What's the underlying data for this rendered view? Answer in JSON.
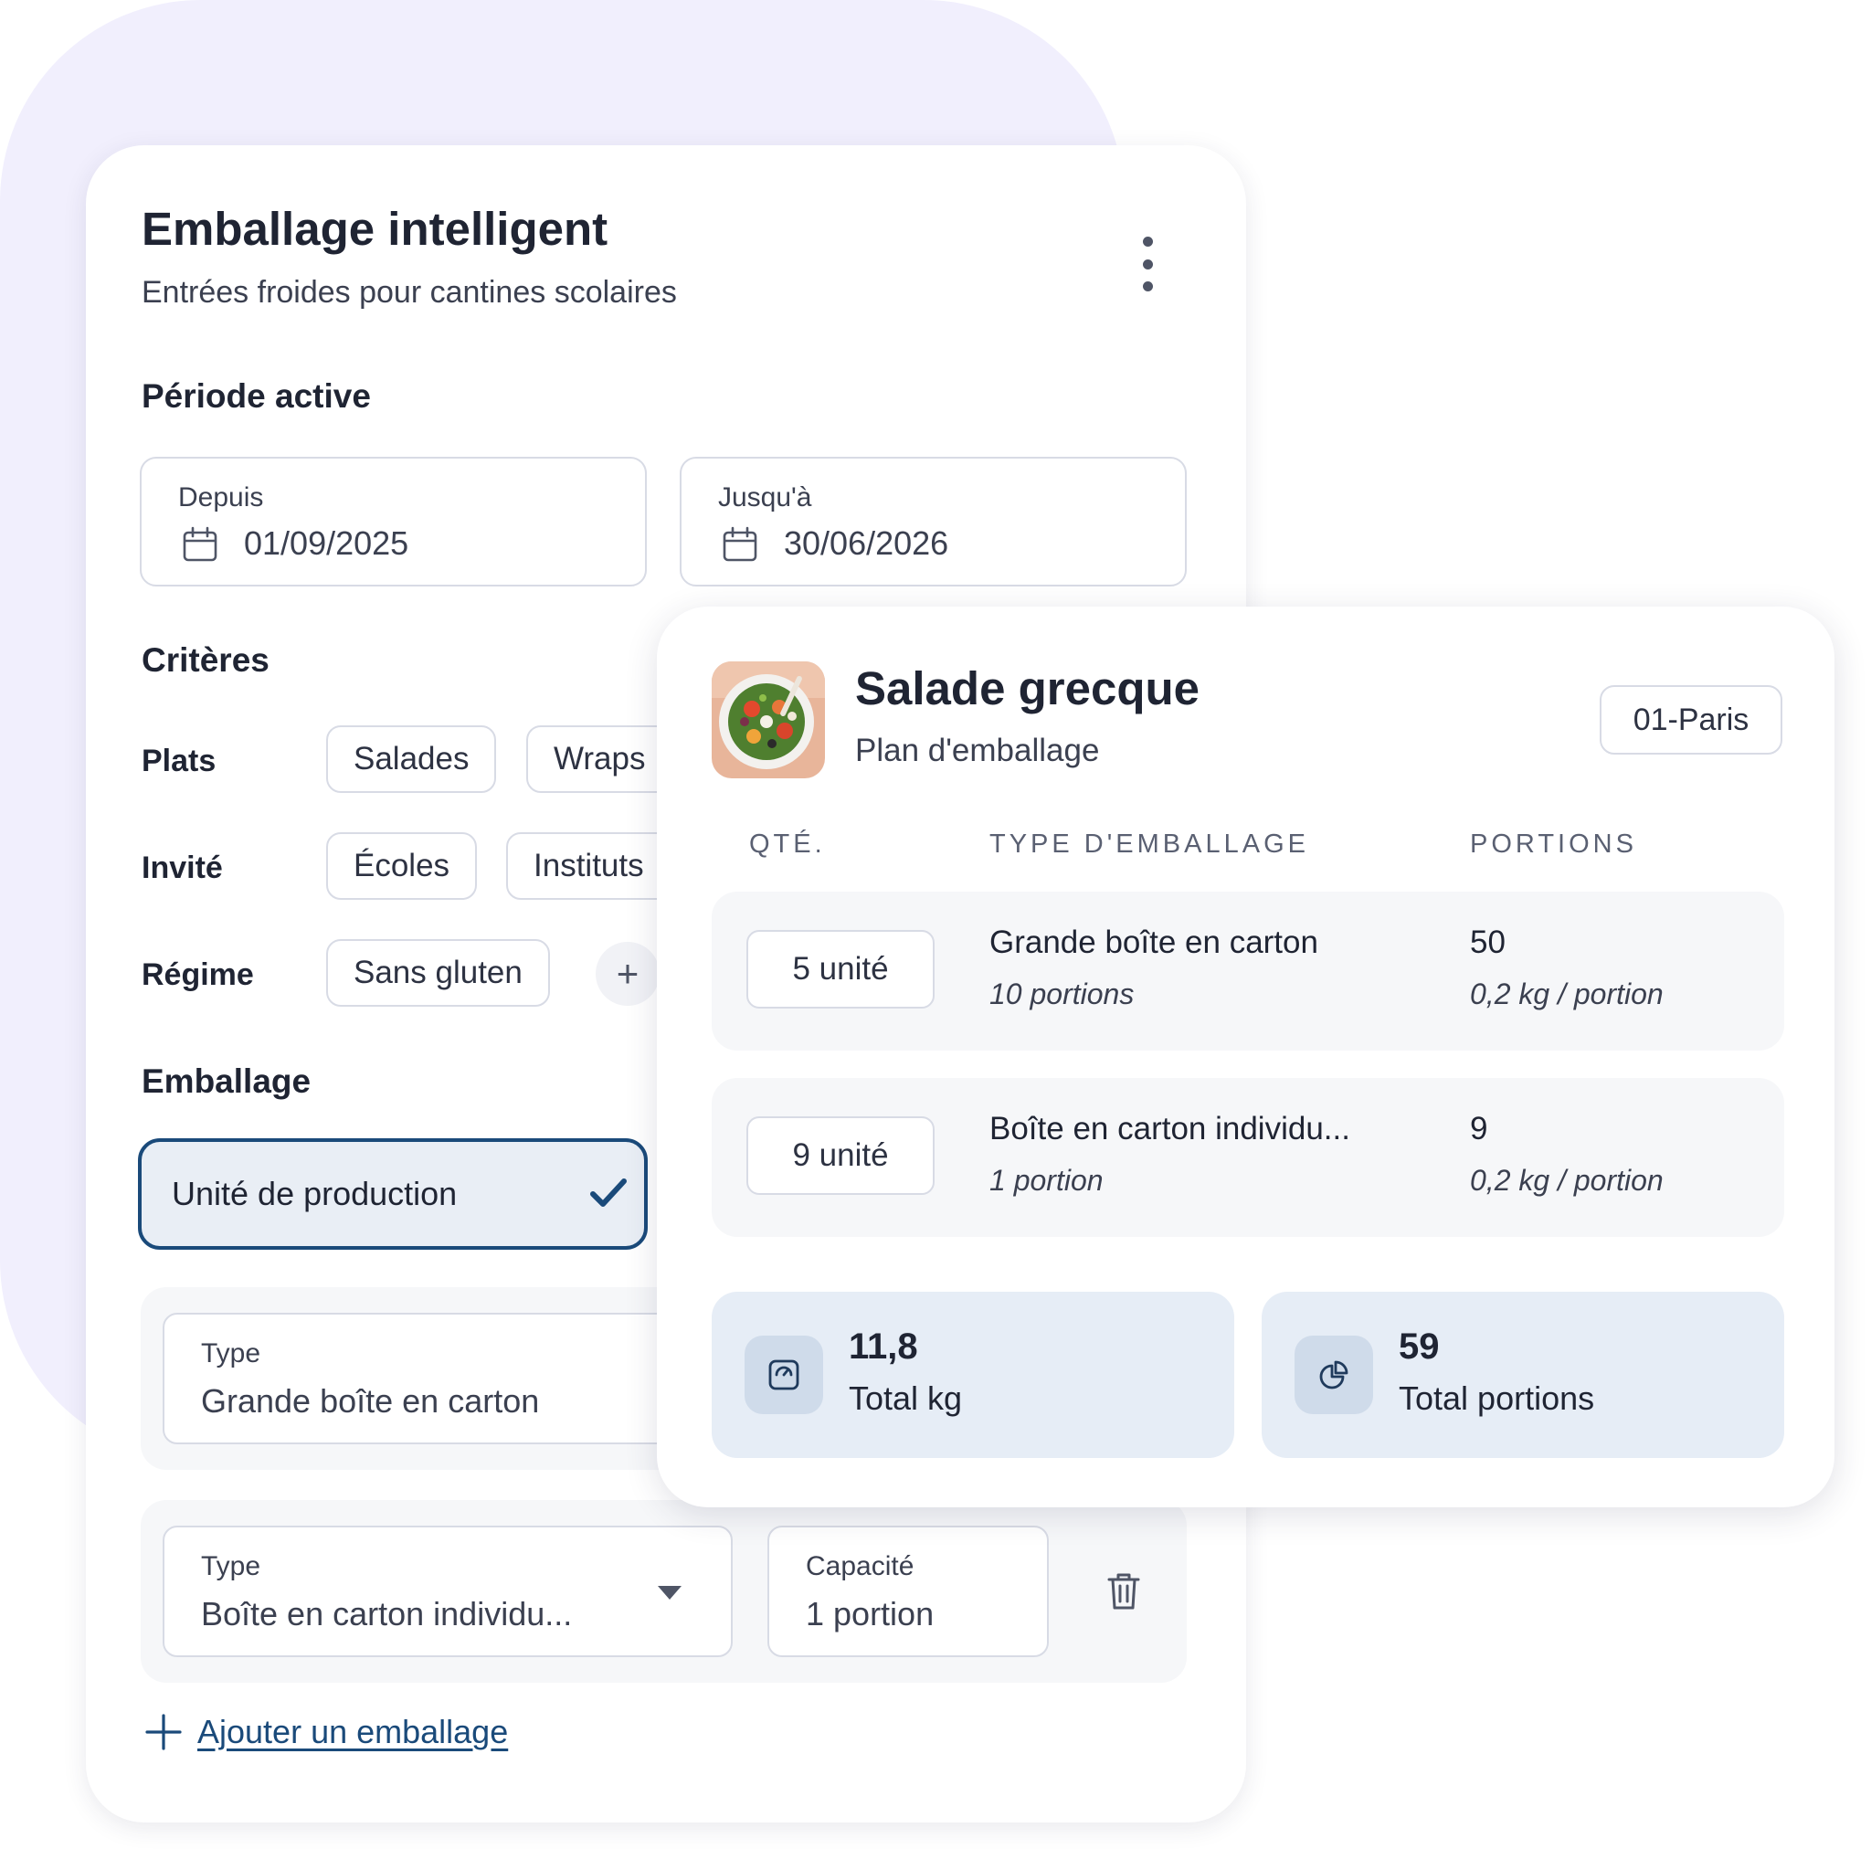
{
  "left_card": {
    "title": "Emballage intelligent",
    "subtitle": "Entrées froides pour cantines scolaires",
    "menu_icon": "kebab-vertical-icon",
    "period": {
      "heading": "Période active",
      "from": {
        "label": "Depuis",
        "value": "01/09/2025",
        "icon": "calendar-icon"
      },
      "to": {
        "label": "Jusqu'à",
        "value": "30/06/2026",
        "icon": "calendar-icon"
      }
    },
    "criteria": {
      "heading": "Critères",
      "plats": {
        "label": "Plats",
        "chips": [
          "Salades",
          "Wraps"
        ]
      },
      "invite": {
        "label": "Invité",
        "chips": [
          "Écoles",
          "Instituts"
        ]
      },
      "regime": {
        "label": "Régime",
        "chips": [
          "Sans gluten"
        ],
        "add_symbol": "+"
      }
    },
    "packaging": {
      "heading": "Emballage",
      "selected": "Unité de production",
      "rows": [
        {
          "type_label": "Type",
          "type_value": "Grande boîte en carton"
        },
        {
          "type_label": "Type",
          "type_value": "Boîte en carton individu...",
          "capacity_label": "Capacité",
          "capacity_value": "1 portion"
        }
      ],
      "add_label": "Ajouter un emballage"
    }
  },
  "right_card": {
    "title": "Salade grecque",
    "subtitle": "Plan d'emballage",
    "location": "01-Paris",
    "columns": [
      "QTÉ.",
      "TYPE D'EMBALLAGE",
      "PORTIONS"
    ],
    "rows": [
      {
        "qty": "5 unité",
        "type": "Grande boîte en carton",
        "type_sub": "10 portions",
        "portions": "50",
        "portions_sub": "0,2 kg / portion"
      },
      {
        "qty": "9 unité",
        "type": "Boîte en carton individu...",
        "type_sub": "1 portion",
        "portions": "9",
        "portions_sub": "0,2 kg / portion"
      }
    ],
    "stats": [
      {
        "value": "11,8",
        "label": "Total kg",
        "icon": "scale-icon"
      },
      {
        "value": "59",
        "label": "Total portions",
        "icon": "pie-chart-icon"
      }
    ]
  },
  "colors": {
    "accent": "#1a4a7a",
    "background_blob": "#f1effd",
    "stat_bg": "#e6edf6",
    "row_bg": "#f6f7f9",
    "border": "#d8dbe5"
  }
}
